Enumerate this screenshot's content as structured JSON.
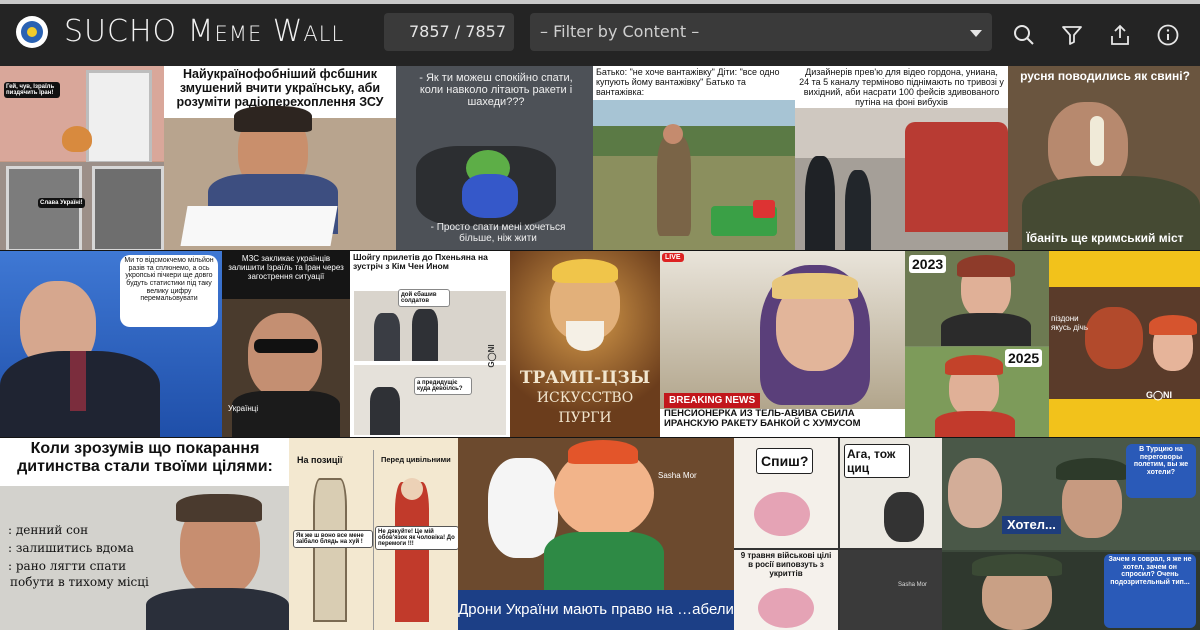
{
  "app": {
    "title_first": "SUCHO",
    "title_second": "Meme",
    "title_third": "Wall",
    "counter": "7857 / 7857",
    "filter_placeholder": "– Filter by Content –"
  },
  "toolbar": {
    "icons": [
      "search-icon",
      "filter-icon",
      "share-icon",
      "info-icon"
    ]
  },
  "memes": {
    "cat": {
      "top": "Гей, чув, Ізраїль пиздячить Іран!",
      "bottom": "Слава Україні!"
    },
    "crying": {
      "caption": "Найукраїнофобніший фсбшник змушений вчити українську, аби розуміти радіоперехоплення ЗСУ"
    },
    "pepe": {
      "top": "- Як ти можеш спокійно спати, коли навколо літають ракети і шахеди???",
      "bottom": "- Просто спати мені хочеться більше, ніж жити"
    },
    "truck": {
      "caption": "Батько: \"не хоче вантажівку\" Діти: \"все одно купують йому вантажівку\" Батько та вантажівка:"
    },
    "designers": {
      "caption": "Дизайнерів прев'ю для відео гордона, униана, 24 та 5 каналу терміново піднімають по тривозі у вихідний, аби насрати 100 фейсів здивованого путіна на фоні вибухів"
    },
    "zelensky": {
      "top": "русня поводились як свині?",
      "bottom": "Їбаніть ще кримський міст"
    },
    "putin": {
      "caption": "Ми то відсмокчемо мільйон разів та сплюнемо, а ось укропські пічкери ще довго будуть статистики під таку велику цифру перемальовувати"
    },
    "mzs": {
      "caption": "МЗС закликає українців залишити Ізраїль та Іран через загострення ситуації",
      "bottom": "Українці"
    },
    "shoigu": {
      "caption": "Шойгу прилетів до Пхеньяна на зустріч з Кім Чен Ином",
      "bubble1": "дой єбашив солдатов",
      "bubble2": "а предидущіє куда девоілсь?",
      "brand": "G◯NI"
    },
    "trump": {
      "line1": "ТРАМП-ЦЗЫ",
      "line2": "ИСКУССТВО",
      "line3": "ПУРГИ"
    },
    "breaking": {
      "live": "LIVE",
      "label": "BREAKING NEWS",
      "headline": "ПЕНСИОНЕРКА ИЗ ТЕЛЬ-АВИВА СБИЛА ИРАНСКУЮ РАКЕТУ БАНКОЙ С ХУМУСОМ"
    },
    "years": {
      "y1": "2023",
      "y2": "2025"
    },
    "devil": {
      "caption": "піздони якусь дічь",
      "brand": "G◯NI"
    },
    "office": {
      "title": "Коли зрозумів що покарання дитинства стали твоїми цілями:",
      "l1": ": денний сон",
      "l2": ": залишитись вдома",
      "l3": ": рано лягти спати",
      "l4": "побути в тихому місці"
    },
    "skeleton": {
      "left": "На позиції",
      "right": "Перед цивільними",
      "b1": "Як же ш воно все мене заїбало блядь на хуй !",
      "b2": "Не дякуйте! Це мій обов'язок як чоловіка! До перемоги !!!"
    },
    "carlson": {
      "sig": "Sasha Mor",
      "bottom": "Дрони України мають право на …абели"
    },
    "brain": {
      "q1": "Спиш?",
      "q2": "Ага, тож циц",
      "sig": "Sasha Mor",
      "text": "9 травня військові цілі в росії виповзуть з укриттів"
    },
    "turkey": {
      "top": "В Турцию на переговоры полетим, вы же хотели?",
      "mid": "Хотел...",
      "bottom": "Зачем я соврал, я же не хотел, зачем он спросил? Очень подозрительный тип..."
    }
  }
}
